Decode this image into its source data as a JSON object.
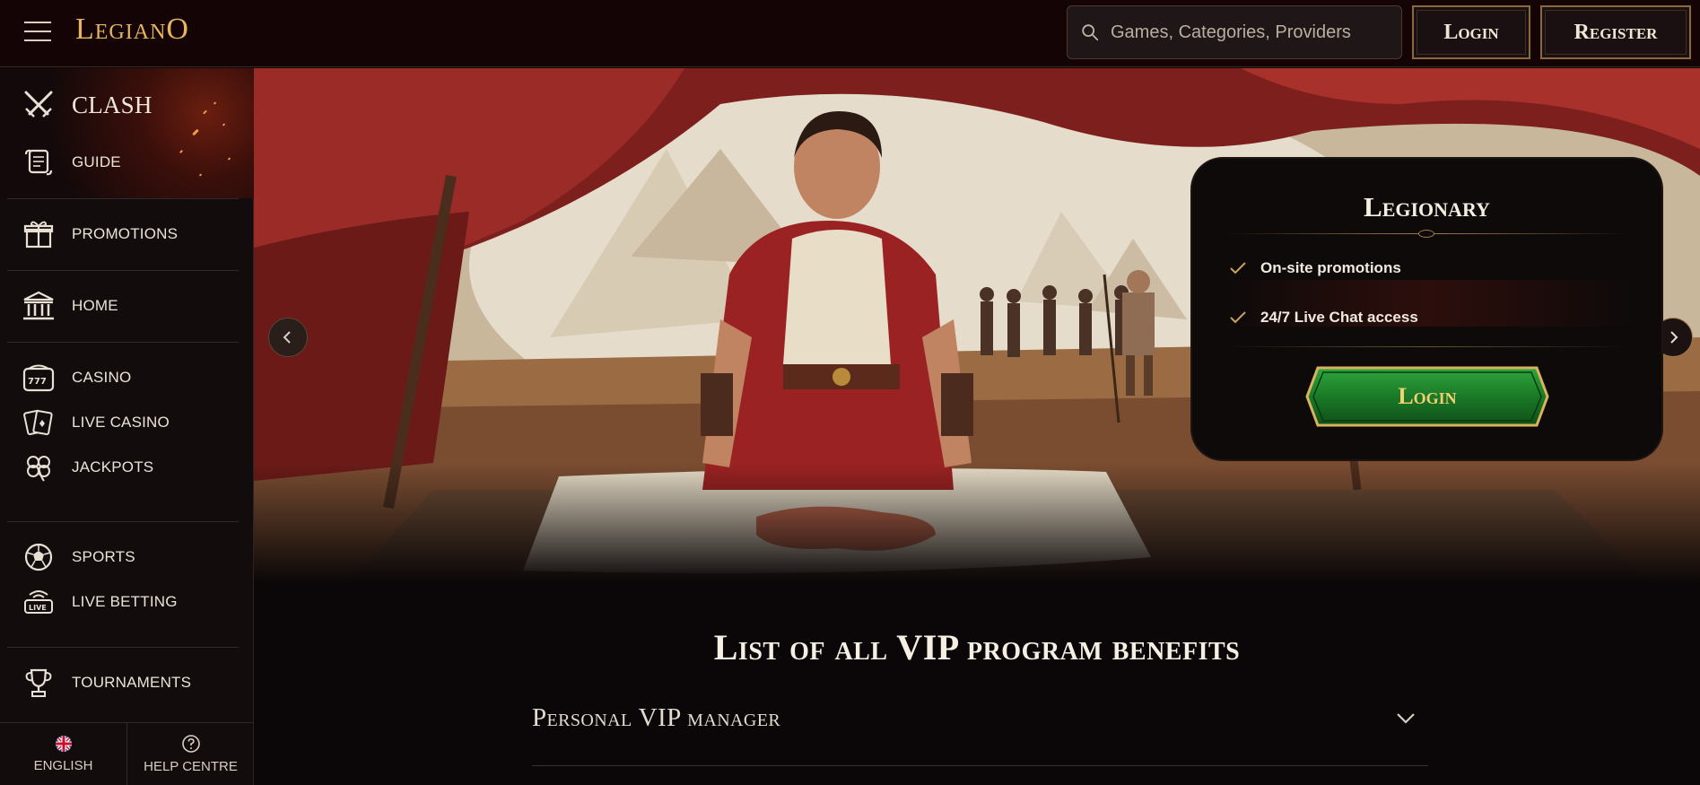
{
  "header": {
    "logo": "LegianO",
    "search_placeholder": "Games, Categories, Providers",
    "login_label": "Login",
    "register_label": "Register"
  },
  "sidebar": {
    "clash": {
      "label": "CLASH",
      "icon": "crossed-swords-icon"
    },
    "items": [
      {
        "label": "GUIDE",
        "icon": "scroll-icon"
      },
      {
        "label": "PROMOTIONS",
        "icon": "gift-icon"
      },
      {
        "label": "HOME",
        "icon": "temple-icon"
      },
      {
        "label": "CASINO",
        "icon": "slot-machine-icon"
      },
      {
        "label": "LIVE CASINO",
        "icon": "playing-cards-icon"
      },
      {
        "label": "JACKPOTS",
        "icon": "clover-icon"
      },
      {
        "label": "SPORTS",
        "icon": "soccer-ball-icon"
      },
      {
        "label": "LIVE BETTING",
        "icon": "live-broadcast-icon"
      },
      {
        "label": "TOURNAMENTS",
        "icon": "trophy-icon"
      }
    ],
    "footer": {
      "language_label": "ENGLISH",
      "help_label": "HELP CENTRE"
    }
  },
  "hero": {
    "rank_card": {
      "title": "Legionary",
      "benefits": [
        "On-site promotions",
        "24/7 Live Chat access"
      ],
      "login_label": "Login"
    }
  },
  "benefits_section": {
    "title": "List of all VIP program benefits",
    "items": [
      {
        "title": "Personal VIP manager"
      }
    ]
  },
  "colors": {
    "accent_gold": "#e7b65c",
    "background": "#0b0708",
    "login_green": "#1f8a2e"
  }
}
